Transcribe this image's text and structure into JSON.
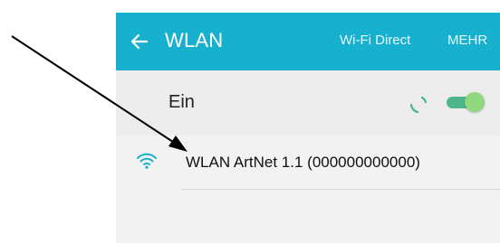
{
  "appbar": {
    "title": "WLAN",
    "back_icon": "arrow-left-icon",
    "actions": [
      {
        "label": "Wi-Fi Direct"
      },
      {
        "label": "MEHR"
      }
    ],
    "background_color": "#17b1cf"
  },
  "wlan_toggle": {
    "label": "Ein",
    "state": "on",
    "spinner_icon": "loading-spinner-icon",
    "accent_color": "#4db58a"
  },
  "networks": [
    {
      "name": "WLAN ArtNet 1.1 (000000000000)",
      "icon": "wifi-icon",
      "icon_color": "#17b1cf"
    }
  ],
  "annotation": {
    "type": "arrow",
    "color": "#000000"
  }
}
